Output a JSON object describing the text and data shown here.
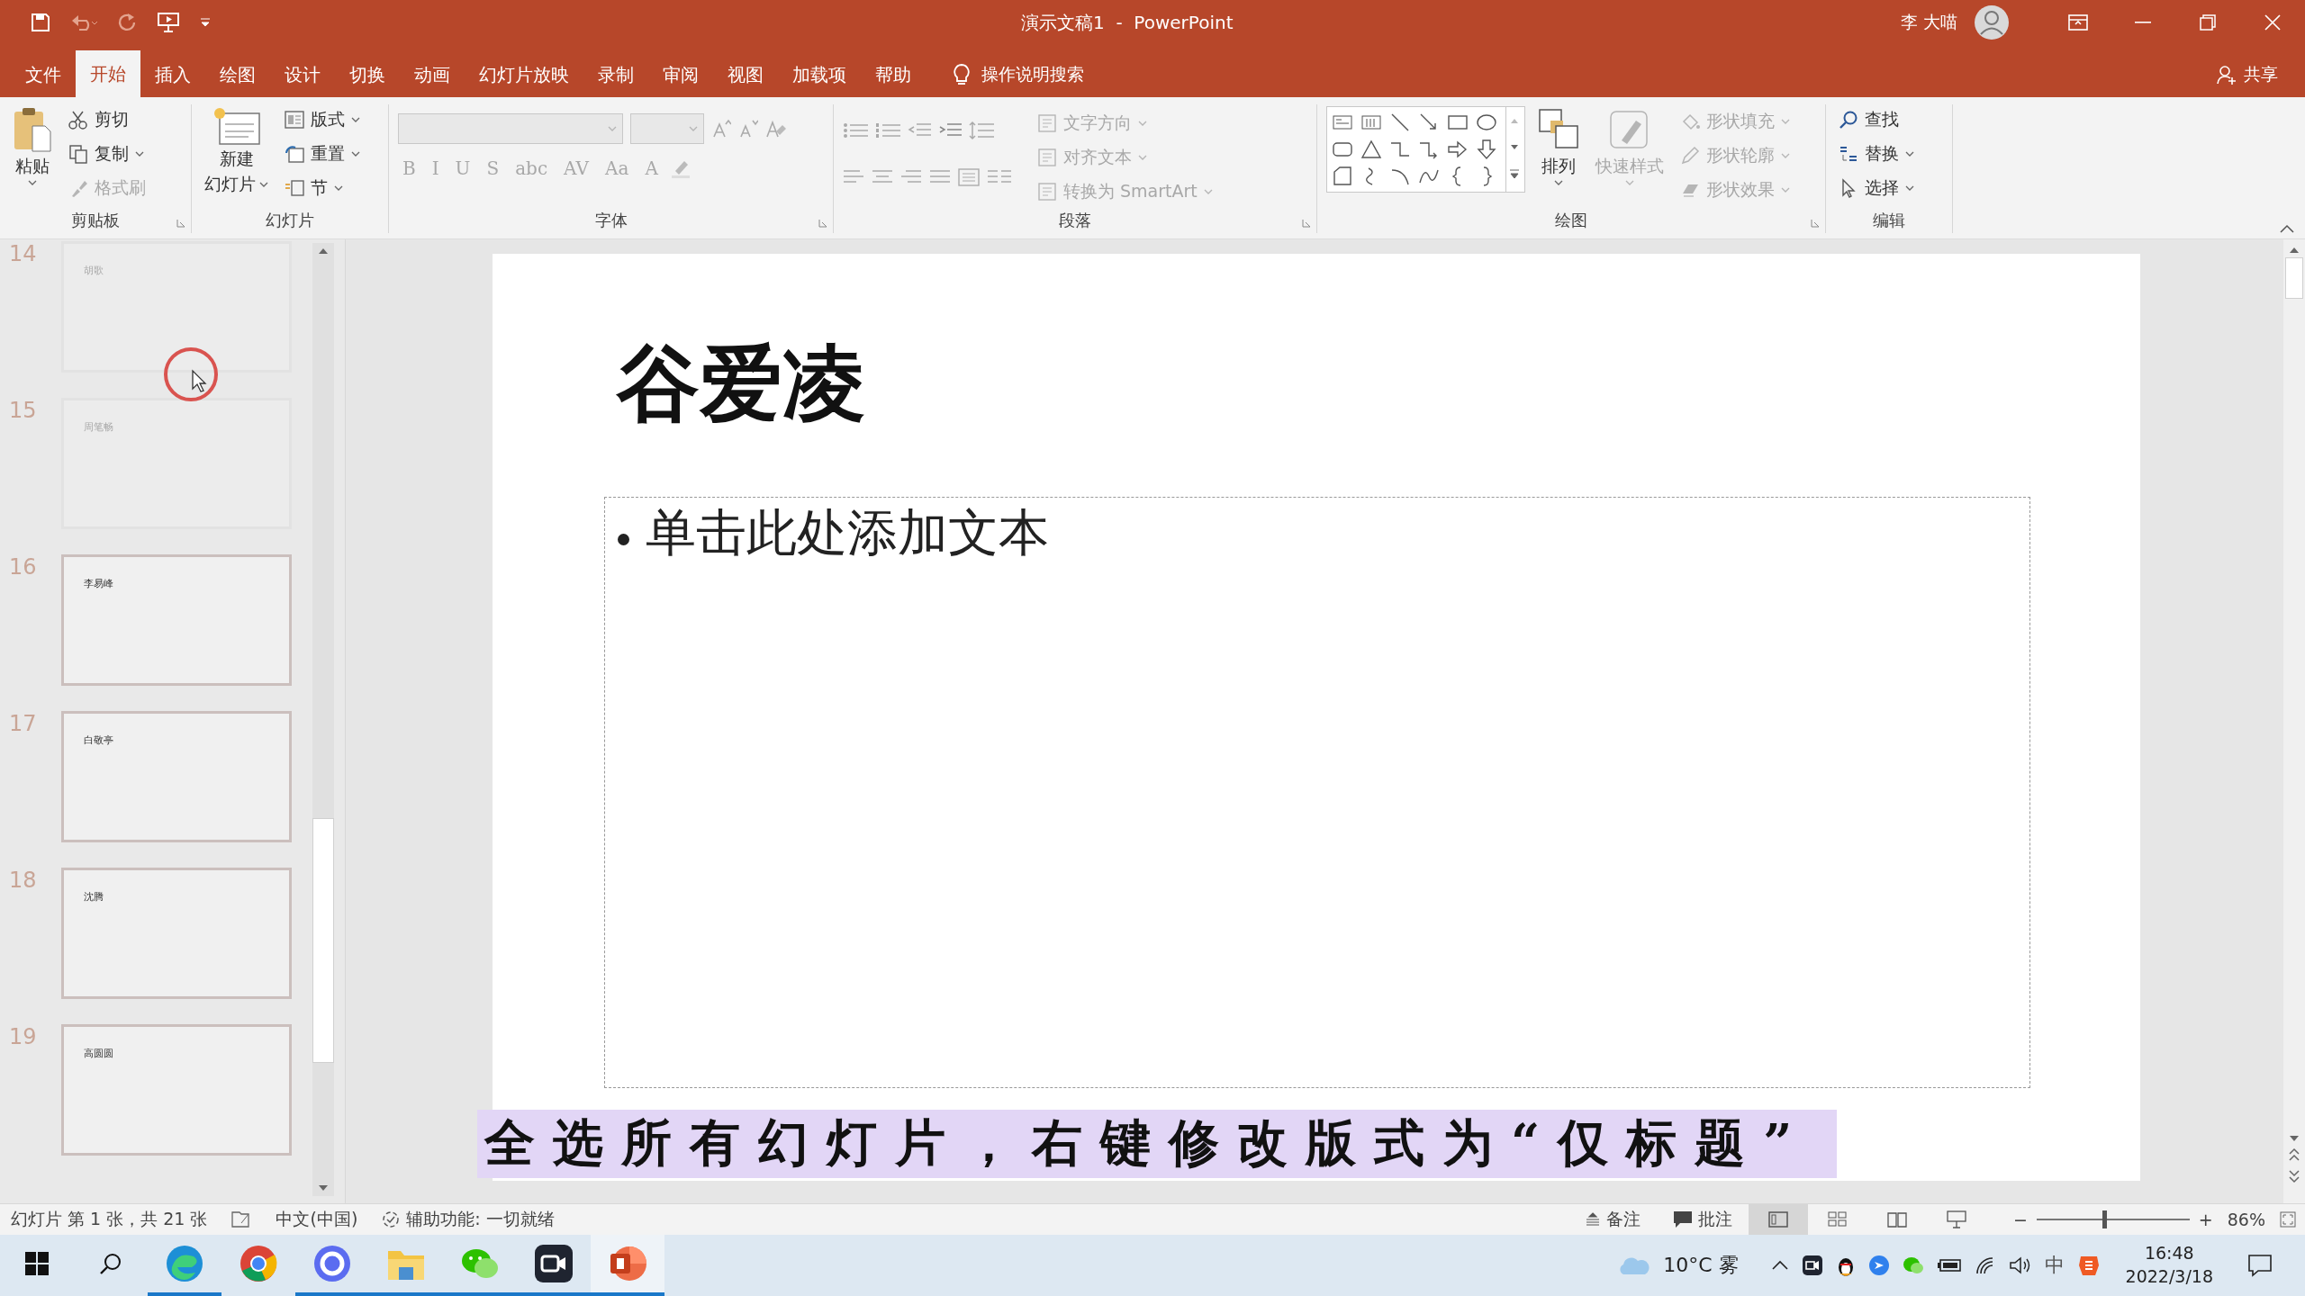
{
  "window": {
    "title": "演示文稿1  -  PowerPoint",
    "user": "李 大喵"
  },
  "tabs": [
    {
      "label": "文件",
      "selected": false
    },
    {
      "label": "开始",
      "selected": true
    },
    {
      "label": "插入",
      "selected": false
    },
    {
      "label": "绘图",
      "selected": false
    },
    {
      "label": "设计",
      "selected": false
    },
    {
      "label": "切换",
      "selected": false
    },
    {
      "label": "动画",
      "selected": false
    },
    {
      "label": "幻灯片放映",
      "selected": false
    },
    {
      "label": "录制",
      "selected": false
    },
    {
      "label": "审阅",
      "selected": false
    },
    {
      "label": "视图",
      "selected": false
    },
    {
      "label": "加载项",
      "selected": false
    },
    {
      "label": "帮助",
      "selected": false
    }
  ],
  "tell_me": "操作说明搜索",
  "share": "共享",
  "ribbon": {
    "clipboard": {
      "label": "剪贴板",
      "paste": "粘贴",
      "items": [
        {
          "label": "剪切",
          "disabled": false
        },
        {
          "label": "复制",
          "disabled": false
        },
        {
          "label": "格式刷",
          "disabled": true
        }
      ]
    },
    "slides": {
      "label": "幻灯片",
      "new_slide": [
        "新建",
        "幻灯片"
      ],
      "items": [
        {
          "label": "版式",
          "disabled": false
        },
        {
          "label": "重置",
          "disabled": false
        },
        {
          "label": "节",
          "disabled": false
        }
      ]
    },
    "font": {
      "label": "字体",
      "buttons": [
        "B",
        "I",
        "U",
        "S",
        "abc",
        "AV",
        "Aa",
        "A"
      ]
    },
    "paragraph": {
      "label": "段落",
      "items": [
        {
          "label": "文字方向",
          "disabled": true
        },
        {
          "label": "对齐文本",
          "disabled": true
        },
        {
          "label": "转换为 SmartArt",
          "disabled": true
        }
      ]
    },
    "drawing": {
      "label": "绘图",
      "arrange": "排列",
      "quick_styles": {
        "label": "快速样式",
        "disabled": true
      },
      "items": [
        {
          "label": "形状填充",
          "disabled": true
        },
        {
          "label": "形状轮廓",
          "disabled": true
        },
        {
          "label": "形状效果",
          "disabled": true
        }
      ]
    },
    "editing": {
      "label": "编辑",
      "items": [
        {
          "label": "查找",
          "disabled": false
        },
        {
          "label": "替换",
          "disabled": false
        },
        {
          "label": "选择",
          "disabled": false
        }
      ]
    }
  },
  "thumbnails": [
    {
      "number": "14",
      "title": "胡歌",
      "dimmed": true
    },
    {
      "number": "15",
      "title": "周笔畅",
      "dimmed": true
    },
    {
      "number": "16",
      "title": "李易峰",
      "dimmed": false
    },
    {
      "number": "17",
      "title": "白敬亭",
      "dimmed": false
    },
    {
      "number": "18",
      "title": "沈腾",
      "dimmed": false
    },
    {
      "number": "19",
      "title": "高圆圆",
      "dimmed": false
    }
  ],
  "slide": {
    "title": "谷爱凌",
    "placeholder": "单击此处添加文本"
  },
  "caption": "全选所有幻灯片，右键修改版式为“仅标题”",
  "status_bar": {
    "slide_info": "幻灯片 第 1 张，共 21 张",
    "language": "中文(中国)",
    "accessibility": "辅助功能: 一切就绪",
    "notes": "备注",
    "comments": "批注",
    "views": [
      {
        "kind": "normal",
        "selected": true
      },
      {
        "kind": "sorter",
        "selected": false
      },
      {
        "kind": "reading",
        "selected": false
      },
      {
        "kind": "slideshow",
        "selected": false
      }
    ],
    "zoom_minus": "−",
    "zoom_plus": "+",
    "zoom": {
      "level": 0.43,
      "reading": "86%"
    }
  },
  "taskbar": {
    "apps": [
      {
        "kind": "edge",
        "running": true,
        "active": false
      },
      {
        "kind": "chrome",
        "running": false,
        "active": false
      },
      {
        "kind": "ring",
        "running": true,
        "active": false
      },
      {
        "kind": "folder",
        "running": true,
        "active": false
      },
      {
        "kind": "wechat",
        "running": true,
        "active": false
      },
      {
        "kind": "camera",
        "running": true,
        "active": false
      },
      {
        "kind": "powerpoint",
        "running": true,
        "active": true
      }
    ],
    "weather": "10°C 雾",
    "ime": "中",
    "time": "16:48",
    "date": "2022/3/18"
  }
}
